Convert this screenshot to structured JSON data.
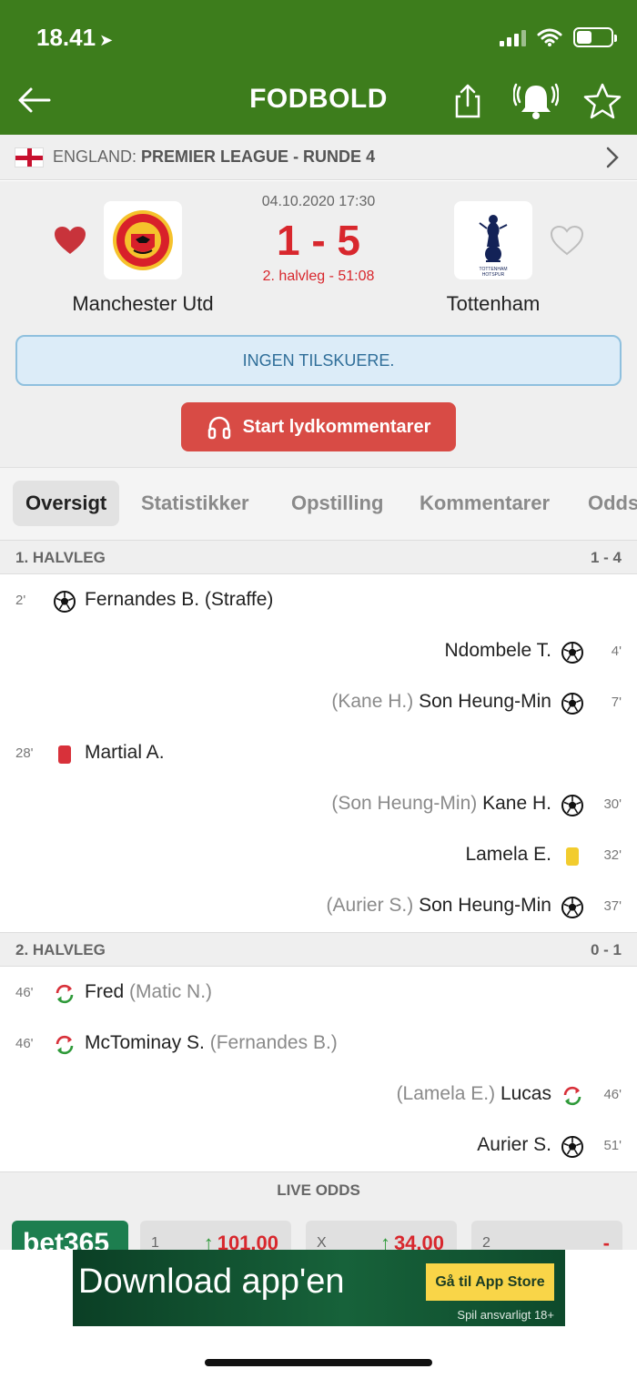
{
  "status_bar": {
    "time": "18.41"
  },
  "nav": {
    "title": "FODBOLD"
  },
  "league": {
    "country": "ENGLAND:",
    "competition": "PREMIER LEAGUE - RUNDE 4"
  },
  "match": {
    "date": "04.10.2020 17:30",
    "score": "1 - 5",
    "status": "2. halvleg - 51:08",
    "home": "Manchester Utd",
    "away": "Tottenham",
    "info": "INGEN TILSKUERE.",
    "audio_button": "Start lydkommentarer"
  },
  "tabs": [
    "Oversigt",
    "Statistikker",
    "Opstilling",
    "Kommentarer",
    "Odds"
  ],
  "halves": [
    {
      "label": "1. HALVLEG",
      "score": "1 - 4",
      "events": [
        {
          "minute": "2'",
          "side": "home",
          "type": "goal",
          "player": "Fernandes B.",
          "extra": "(Straffe)"
        },
        {
          "minute": "4'",
          "side": "away",
          "type": "goal",
          "player": "Ndombele T.",
          "extra": ""
        },
        {
          "minute": "7'",
          "side": "away",
          "type": "goal",
          "player": "Son Heung-Min",
          "extra": "(Kane H.)"
        },
        {
          "minute": "28'",
          "side": "home",
          "type": "red-card",
          "player": "Martial A.",
          "extra": ""
        },
        {
          "minute": "30'",
          "side": "away",
          "type": "goal",
          "player": "Kane H.",
          "extra": "(Son Heung-Min)"
        },
        {
          "minute": "32'",
          "side": "away",
          "type": "yellow-card",
          "player": "Lamela E.",
          "extra": ""
        },
        {
          "minute": "37'",
          "side": "away",
          "type": "goal",
          "player": "Son Heung-Min",
          "extra": "(Aurier S.)"
        }
      ]
    },
    {
      "label": "2. HALVLEG",
      "score": "0 - 1",
      "events": [
        {
          "minute": "46'",
          "side": "home",
          "type": "substitution",
          "player": "Fred",
          "extra": "(Matic N.)"
        },
        {
          "minute": "46'",
          "side": "home",
          "type": "substitution",
          "player": "McTominay S.",
          "extra": "(Fernandes B.)"
        },
        {
          "minute": "46'",
          "side": "away",
          "type": "substitution",
          "player": "Lucas",
          "extra": "(Lamela E.)"
        },
        {
          "minute": "51'",
          "side": "away",
          "type": "goal",
          "player": "Aurier S.",
          "extra": ""
        }
      ]
    }
  ],
  "live_odds": {
    "label": "LIVE ODDS",
    "bookmaker": "bet365",
    "cells": [
      {
        "key": "1",
        "value": "101.00"
      },
      {
        "key": "X",
        "value": "34.00"
      },
      {
        "key": "2",
        "value": "-"
      }
    ]
  },
  "ad": {
    "title": "Download app'en",
    "cta": "Gå til App Store",
    "note": "Spil ansvarligt  18+"
  },
  "colors": {
    "header_green": "#3d7d1c",
    "score_red": "#d8272d",
    "info_blue": "#dcecf8",
    "audio_red": "#d84b45"
  },
  "icons": {
    "goal": "soccer-ball-icon",
    "red-card": "red-card-icon",
    "yellow-card": "yellow-card-icon",
    "substitution": "substitution-arrows-icon"
  }
}
